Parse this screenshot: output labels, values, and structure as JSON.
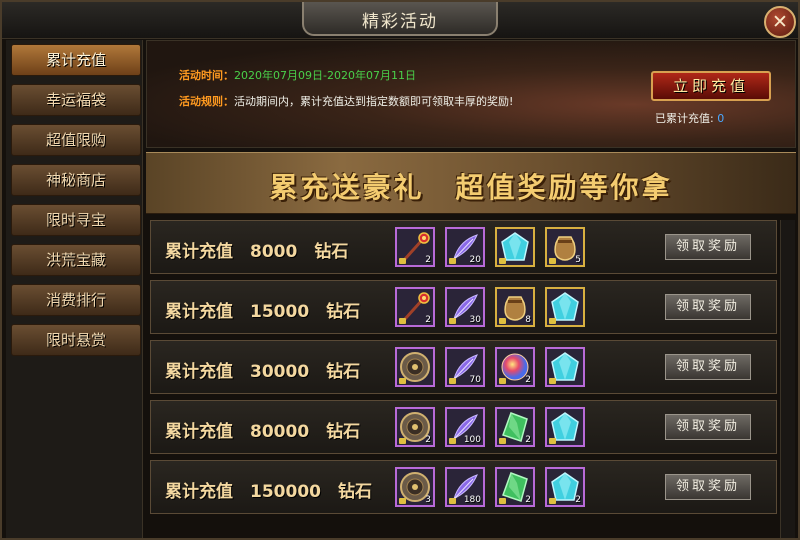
{
  "window": {
    "title": "精彩活动",
    "close_label": "✕"
  },
  "sidebar": {
    "items": [
      {
        "label": "累计充值",
        "active": true
      },
      {
        "label": "幸运福袋",
        "active": false
      },
      {
        "label": "超值限购",
        "active": false
      },
      {
        "label": "神秘商店",
        "active": false
      },
      {
        "label": "限时寻宝",
        "active": false
      },
      {
        "label": "洪荒宝藏",
        "active": false
      },
      {
        "label": "消费排行",
        "active": false
      },
      {
        "label": "限时悬赏",
        "active": false
      }
    ]
  },
  "info": {
    "time_label": "活动时间：",
    "time_value": "2020年07月09日-2020年07月11日",
    "rule_label": "活动规则：",
    "rule_value": "活动期间内，累计充值达到指定数额即可领取丰厚的奖励!",
    "recharge_button": "立即充值",
    "total_label": "已累计充值: ",
    "total_value": "0"
  },
  "banner": {
    "text": "累充送豪礼　超值奖励等你拿"
  },
  "rows": [
    {
      "label": "累计充值　8000　钻石",
      "claim": "领取奖励",
      "items": [
        {
          "icon": "scepter-icon",
          "count": "2"
        },
        {
          "icon": "feather-icon",
          "count": "20"
        },
        {
          "icon": "cyan-gem-icon",
          "count": ""
        },
        {
          "icon": "pouch-icon",
          "count": "5"
        }
      ]
    },
    {
      "label": "累计充值　15000　钻石",
      "claim": "领取奖励",
      "items": [
        {
          "icon": "scepter-icon",
          "count": "2"
        },
        {
          "icon": "feather-icon",
          "count": "30"
        },
        {
          "icon": "pouch-icon",
          "count": "8"
        },
        {
          "icon": "cyan-gem-icon",
          "count": ""
        }
      ]
    },
    {
      "label": "累计充值　30000　钻石",
      "claim": "领取奖励",
      "items": [
        {
          "icon": "compass-disc-icon",
          "count": ""
        },
        {
          "icon": "feather-icon",
          "count": "70"
        },
        {
          "icon": "rainbow-orb-icon",
          "count": "2"
        },
        {
          "icon": "cyan-gem-icon",
          "count": ""
        }
      ]
    },
    {
      "label": "累计充值　80000　钻石",
      "claim": "领取奖励",
      "items": [
        {
          "icon": "compass-disc-icon",
          "count": "2"
        },
        {
          "icon": "feather-icon",
          "count": "100"
        },
        {
          "icon": "green-gem-icon",
          "count": "2"
        },
        {
          "icon": "cyan-gem-icon",
          "count": ""
        }
      ]
    },
    {
      "label": "累计充值　150000　钻石",
      "claim": "领取奖励",
      "items": [
        {
          "icon": "compass-disc-icon",
          "count": "3"
        },
        {
          "icon": "feather-icon",
          "count": "180"
        },
        {
          "icon": "green-gem-icon",
          "count": "2"
        },
        {
          "icon": "cyan-gem-icon",
          "count": "2"
        }
      ]
    }
  ]
}
